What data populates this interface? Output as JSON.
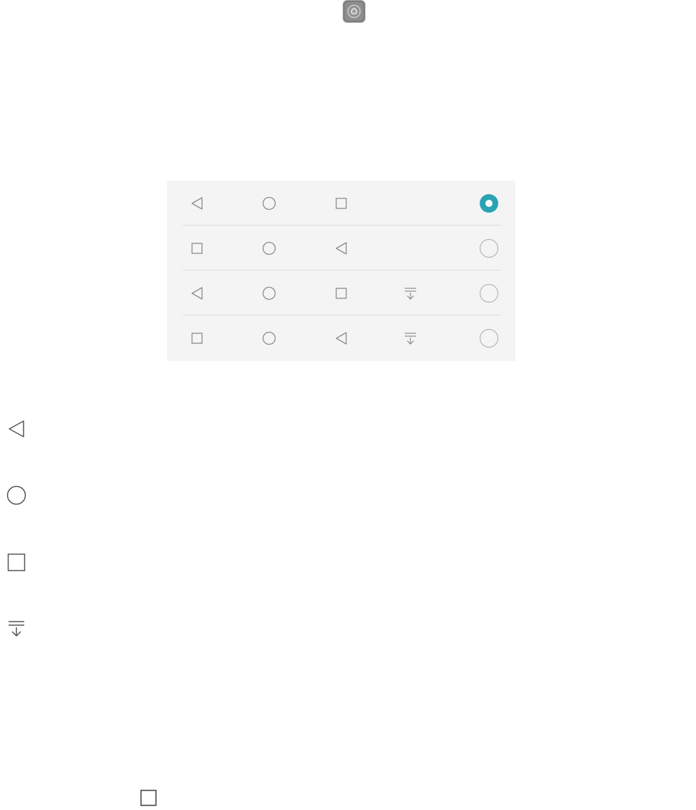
{
  "screen": {
    "background": "#ffffff"
  },
  "top_icon": {
    "name": "settings-app-icon",
    "color": "#8a8a8a"
  },
  "nav_panel": {
    "background": "#f4f4f4",
    "icon_color": "#8c8c8c",
    "accent_color": "#2aa3b4",
    "rows": [
      {
        "buttons": [
          "back",
          "home",
          "recents"
        ],
        "selected": true
      },
      {
        "buttons": [
          "recents",
          "home",
          "back"
        ],
        "selected": false
      },
      {
        "buttons": [
          "back",
          "home",
          "recents",
          "notifications"
        ],
        "selected": false
      },
      {
        "buttons": [
          "recents",
          "home",
          "back",
          "notifications"
        ],
        "selected": false
      }
    ]
  },
  "legend": {
    "icon_color": "#555555",
    "items": [
      "back-icon",
      "home-icon",
      "recents-icon",
      "notification-pulldown-icon"
    ]
  },
  "bottom_icon": {
    "name": "recents-icon",
    "color": "#444444"
  }
}
